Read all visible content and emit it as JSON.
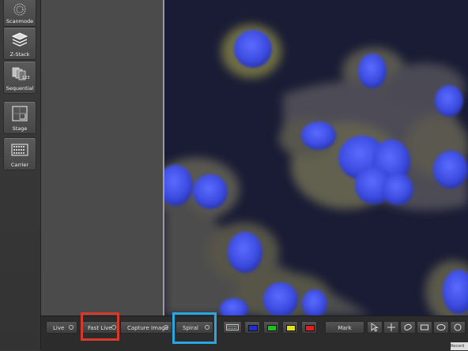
{
  "sidebar": {
    "tools": [
      {
        "label": "Scanmode",
        "icon": "scanmode-icon"
      },
      {
        "label": "Z-Stack",
        "icon": "z-stack-icon"
      },
      {
        "label": "Sequential",
        "icon": "sequential-icon"
      },
      {
        "label": "Stage",
        "icon": "stage-icon"
      },
      {
        "label": "Carrier",
        "icon": "carrier-icon"
      }
    ]
  },
  "toolbar": {
    "live": "Live",
    "fast_live": "Fast Live",
    "capture_image": "Capture Image",
    "spiral": "Spiral",
    "mark": "Mark",
    "channels": [
      "#2030d0",
      "#20c020",
      "#e0e020",
      "#e02020"
    ]
  },
  "corner_text": "Record"
}
